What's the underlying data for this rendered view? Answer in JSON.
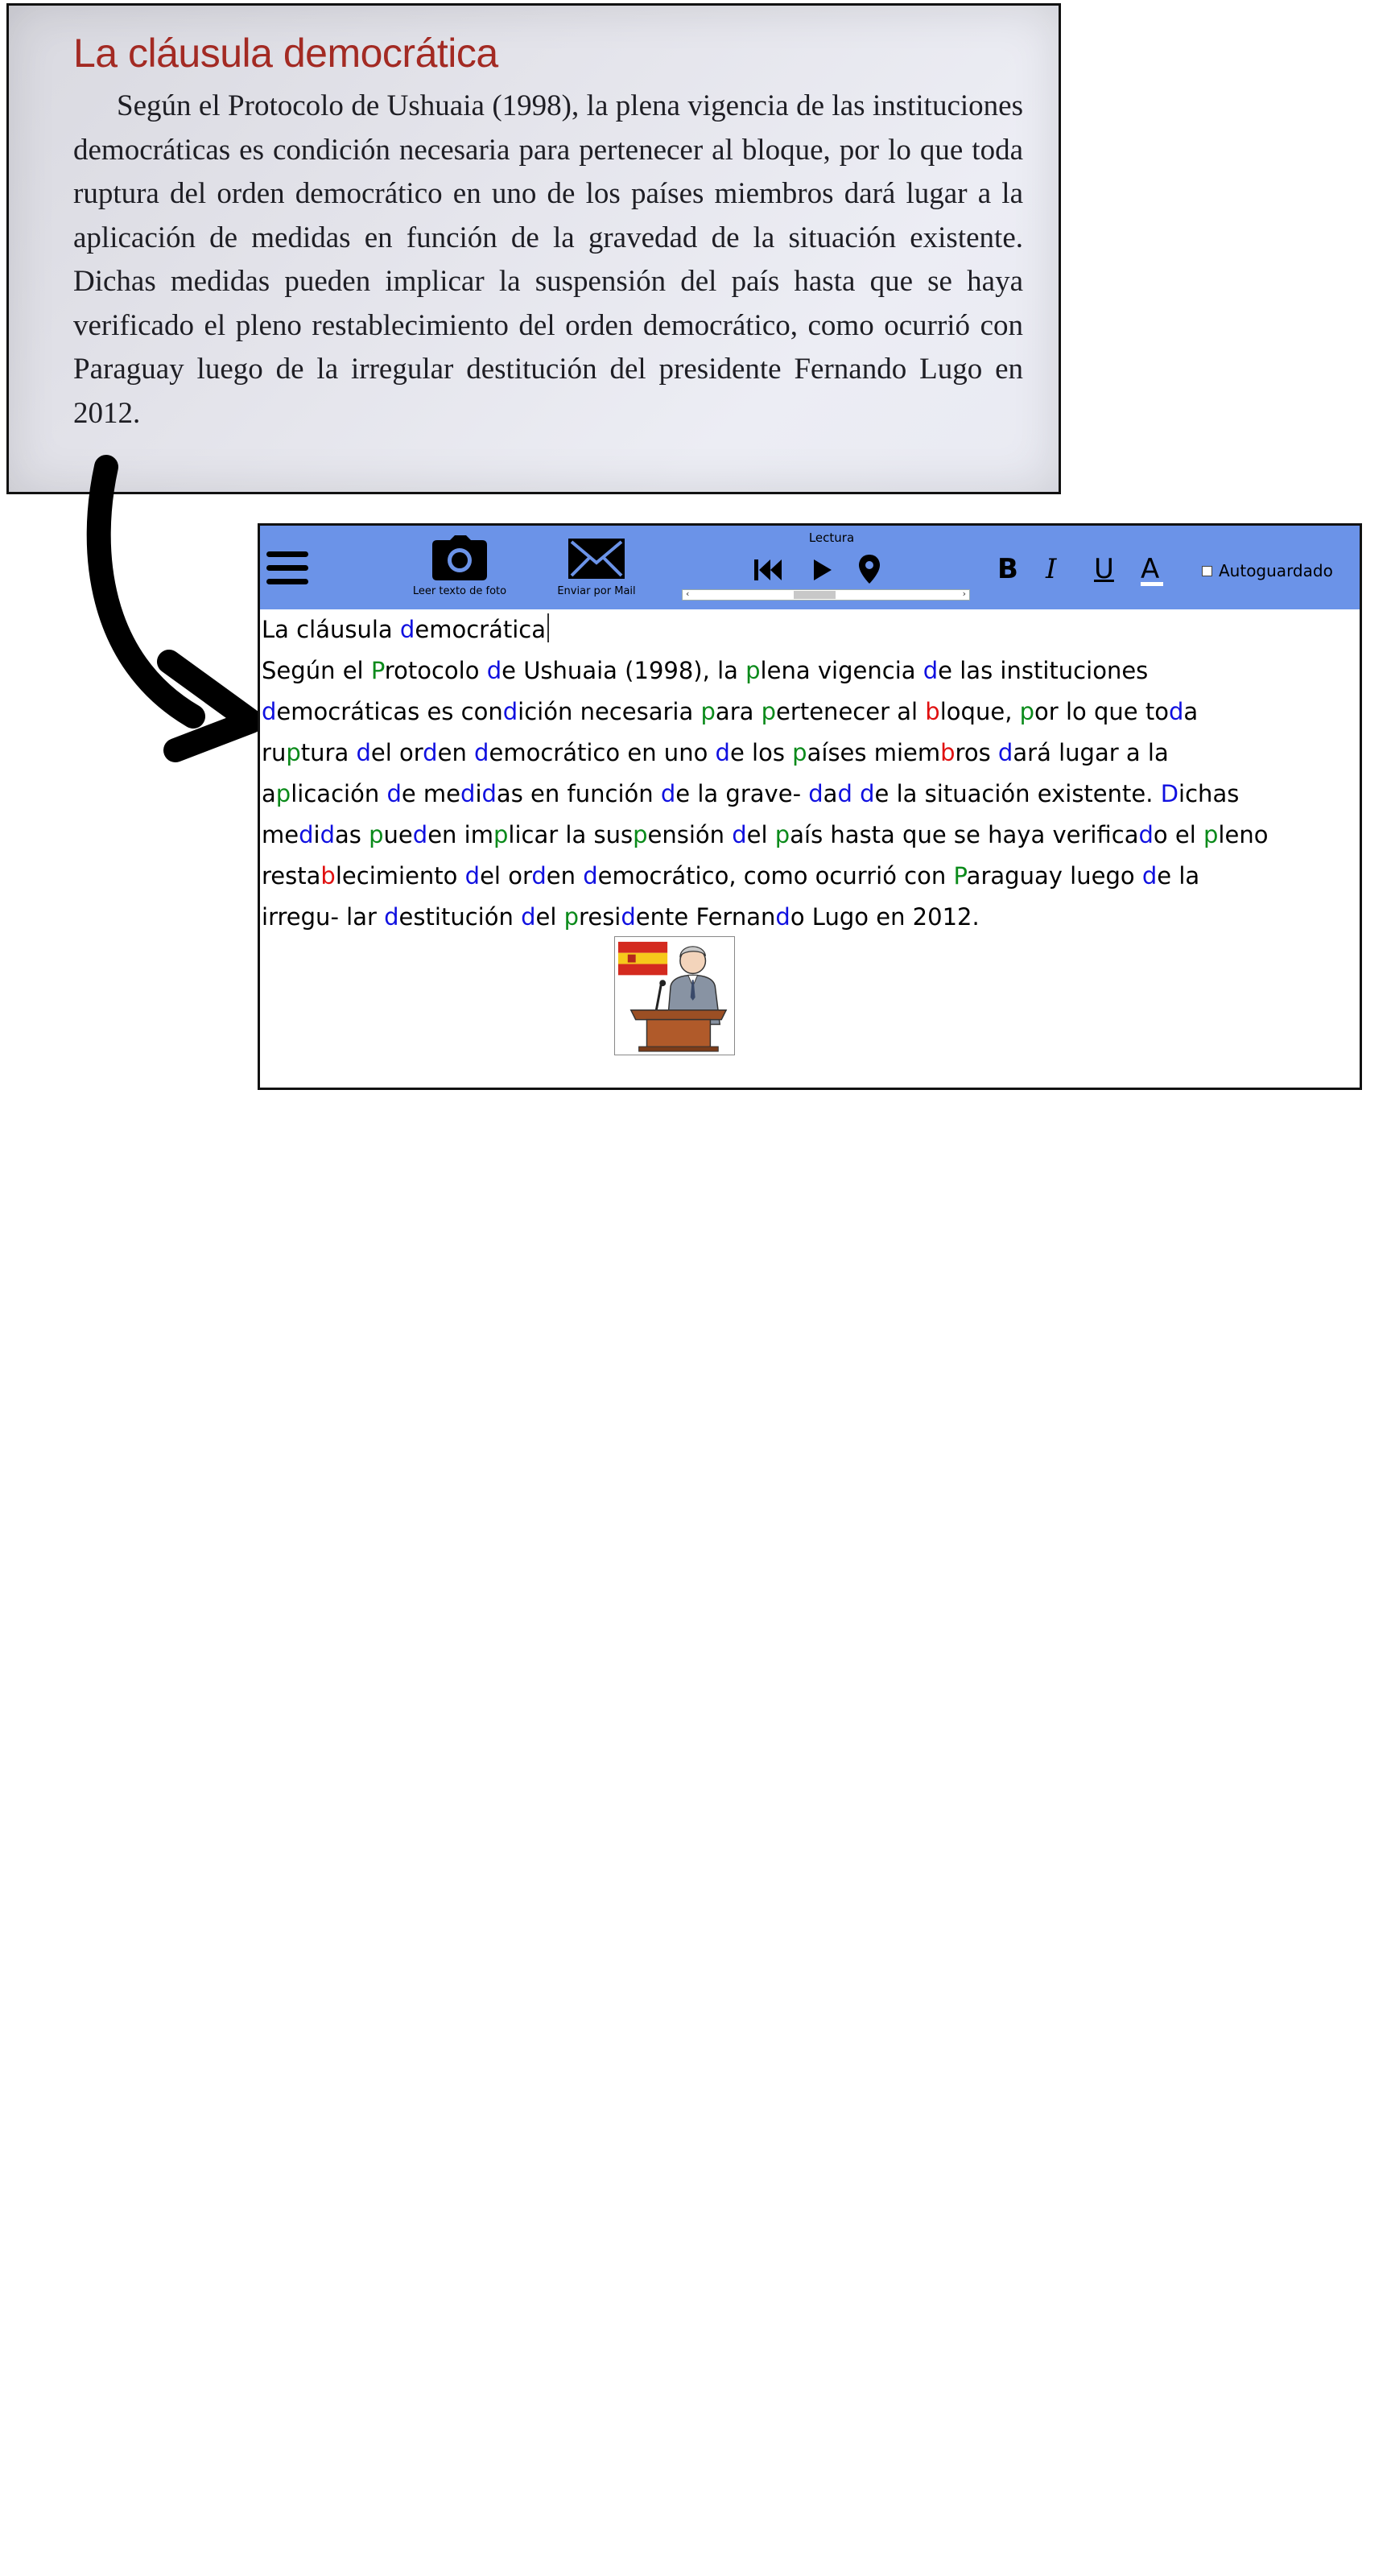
{
  "photo": {
    "title": "La cláusula democrática",
    "body": "Según el Protocolo de Ushuaia (1998), la plena vigencia de las instituciones democráticas es condición necesaria para pertenecer al bloque, por lo que toda ruptura del orden democrático en uno de los países miembros dará lugar a la aplicación de medidas en función de la gravedad de la situación existente. Dichas medidas pueden implicar la suspensión del país hasta que se haya verificado el pleno restablecimiento del orden democrático, como ocurrió con Paraguay luego de la irregular destitución del presidente Fernando Lugo en 2012."
  },
  "toolbar": {
    "camera_caption": "Leer texto de foto",
    "mail_caption": "Enviar por Mail",
    "reading_label": "Lectura",
    "bold_label": "B",
    "italic_label": "I",
    "underline_label": "U",
    "color_label": "A",
    "autosave_label": "Autoguardado",
    "reading_progress": 0.45
  },
  "editor": {
    "lines": [
      "La cláusula democrática",
      "Según el Protocolo de Ushuaia (1998), la plena vigencia de las instituciones",
      "democráticas es condición necesaria para pertenecer al bloque, por lo que toda",
      "ruptura del orden democrático en uno de los países miembros dará lugar a la",
      "aplicación de medidas en función de la grave- dad de la situación existente. Dichas",
      "medidas pueden implicar la suspensión del país hasta que se haya verificado el pleno",
      "restablecimiento del orden democrático, como ocurrió con Paraguay luego de la",
      "irregu- lar destitución del presidente Fernando Lugo en 2012."
    ]
  },
  "colors": {
    "toolbar_bg": "#6b93e8",
    "letter_d": "#1010e0",
    "letter_p": "#0a8a1a",
    "letter_b": "#e01010",
    "photo_title": "#a32a23"
  },
  "icons": [
    "hamburger-menu-icon",
    "camera-icon",
    "mail-icon",
    "rewind-icon",
    "play-icon",
    "location-pin-icon",
    "curved-arrow-icon",
    "spain-flag-icon",
    "speaker-at-podium-pictogram"
  ]
}
